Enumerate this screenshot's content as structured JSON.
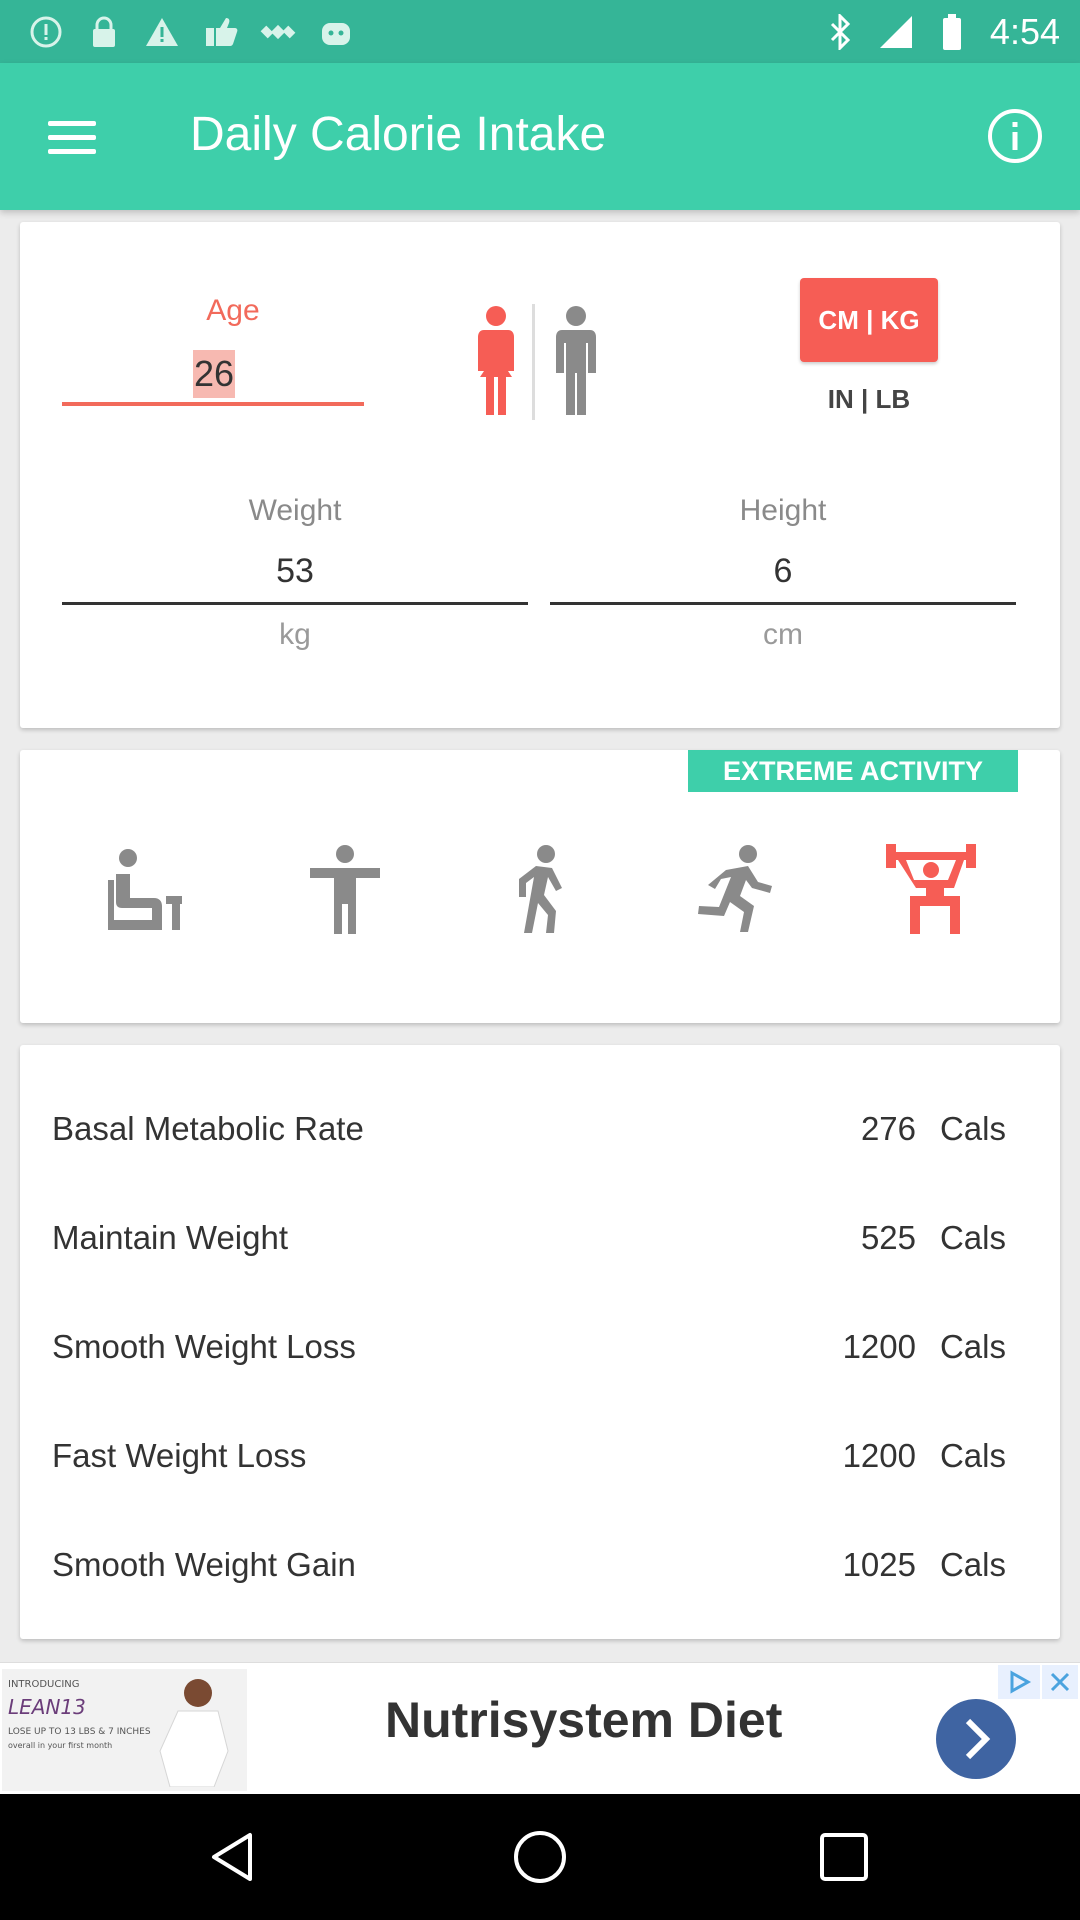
{
  "status_bar": {
    "time": "4:54",
    "icons": [
      "alert-circle-icon",
      "lock-icon",
      "warning-icon",
      "fake-gps-icon",
      "satellite-icon",
      "android-icon",
      "bluetooth-icon",
      "signal-icon",
      "battery-icon"
    ]
  },
  "app_bar": {
    "title": "Daily Calorie Intake",
    "menu_icon": "hamburger-menu-icon",
    "info_icon": "info-icon"
  },
  "colors": {
    "primary": "#3ecfaa",
    "status_bar": "#35b597",
    "accent": "#f65d55",
    "female_active": "#f65d55",
    "inactive_icon": "#8a8a8a",
    "activity_active": "#f65d55"
  },
  "profile": {
    "age_label": "Age",
    "age_value": "26",
    "gender_selected": "female",
    "unit_metric_label": "CM | KG",
    "unit_imperial_label": "IN | LB",
    "unit_selected": "metric",
    "weight_label": "Weight",
    "weight_value": "53",
    "weight_unit": "kg",
    "height_label": "Height",
    "height_value": "6",
    "height_unit": "cm"
  },
  "activity": {
    "selected_label": "EXTREME ACTIVITY",
    "levels": [
      {
        "icon": "sitting-icon",
        "selected": false
      },
      {
        "icon": "standing-icon",
        "selected": false
      },
      {
        "icon": "walking-icon",
        "selected": false
      },
      {
        "icon": "running-icon",
        "selected": false
      },
      {
        "icon": "weightlifting-icon",
        "selected": true
      }
    ]
  },
  "results": [
    {
      "label": "Basal Metabolic Rate",
      "value": "276",
      "unit": "Cals"
    },
    {
      "label": "Maintain Weight",
      "value": "525",
      "unit": "Cals"
    },
    {
      "label": "Smooth Weight Loss",
      "value": "1200",
      "unit": "Cals"
    },
    {
      "label": "Fast Weight Loss",
      "value": "1200",
      "unit": "Cals"
    },
    {
      "label": "Smooth Weight Gain",
      "value": "1025",
      "unit": "Cals"
    }
  ],
  "ad": {
    "title": "Nutrisystem Diet",
    "image_line1": "INTRODUCING",
    "image_line2": "LEAN13",
    "image_line3": "LOSE UP TO 13 LBS & 7 INCHES",
    "image_line4": "overall in your first month",
    "arrow_icon": "chevron-right-icon",
    "adchoices_icon": "adchoices-icon",
    "close_icon": "close-icon"
  },
  "nav_bar": {
    "back_icon": "back-icon",
    "home_icon": "home-icon",
    "recents_icon": "recents-icon"
  }
}
